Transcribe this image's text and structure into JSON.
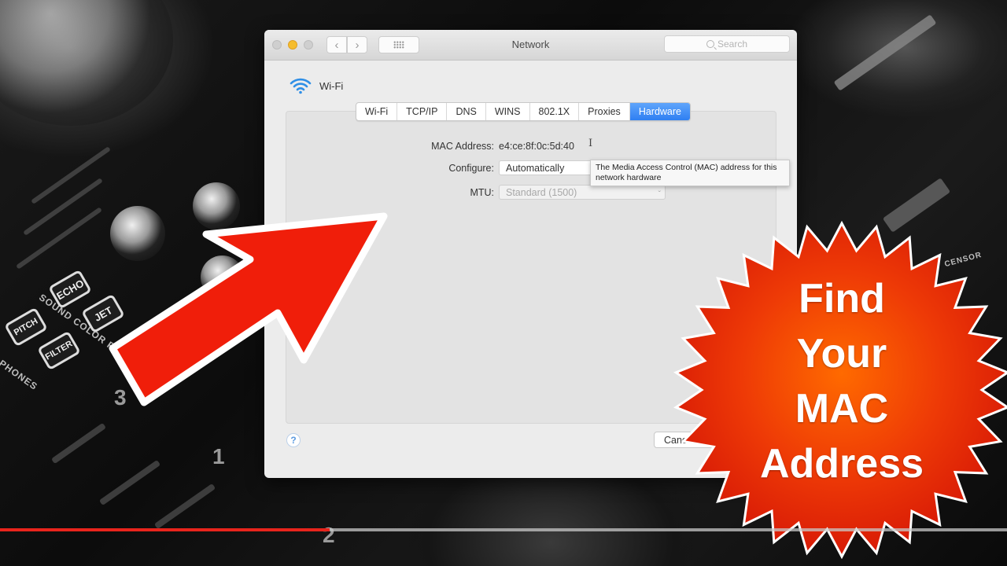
{
  "window": {
    "title": "Network",
    "search_placeholder": "Search",
    "nav": {
      "back_icon": "chevron-left-icon",
      "forward_icon": "chevron-right-icon",
      "grid_icon": "grid-icon"
    }
  },
  "interface": {
    "icon": "wifi-icon",
    "name": "Wi-Fi"
  },
  "tabs": [
    {
      "label": "Wi-Fi",
      "active": false
    },
    {
      "label": "TCP/IP",
      "active": false
    },
    {
      "label": "DNS",
      "active": false
    },
    {
      "label": "WINS",
      "active": false
    },
    {
      "label": "802.1X",
      "active": false
    },
    {
      "label": "Proxies",
      "active": false
    },
    {
      "label": "Hardware",
      "active": true
    }
  ],
  "hardware": {
    "mac_label": "MAC Address:",
    "mac_value": "e4:ce:8f:0c:5d:40",
    "configure_label": "Configure:",
    "configure_value": "Automatically",
    "mtu_label": "MTU:",
    "mtu_value": "Standard  (1500)",
    "tooltip": "The Media Access Control (MAC) address for this network hardware"
  },
  "footer": {
    "help_label": "?",
    "cancel_label": "Cancel"
  },
  "overlay": {
    "badge_lines": [
      "Find",
      "Your",
      "MAC",
      "Address"
    ],
    "badge_color": "#e8280e",
    "arrow_color": "#f01e0a"
  },
  "video": {
    "progress_fraction": 0.327,
    "progress_color": "#e8241c"
  },
  "background": {
    "labels": [
      "ECHO",
      "JET",
      "PITCH",
      "FILTER",
      "SOUND COLOR FX",
      "PHONES",
      "CENSOR"
    ],
    "numbers": [
      "3",
      "1",
      "2"
    ]
  }
}
